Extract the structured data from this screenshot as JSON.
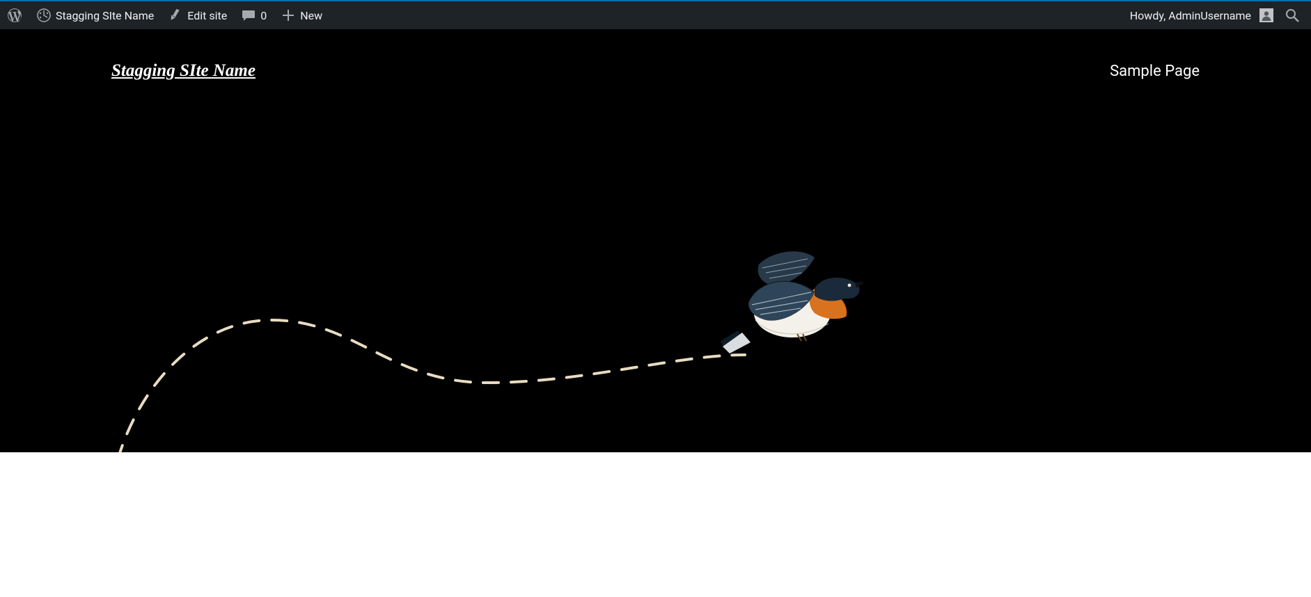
{
  "adminbar": {
    "site_name": "Stagging SIte Name",
    "edit_site": "Edit site",
    "comments_count": "0",
    "new_label": "New",
    "greeting": "Howdy, AdminUsername"
  },
  "site": {
    "title": "Stagging SIte Name",
    "nav": [
      {
        "label": "Sample Page"
      }
    ]
  }
}
